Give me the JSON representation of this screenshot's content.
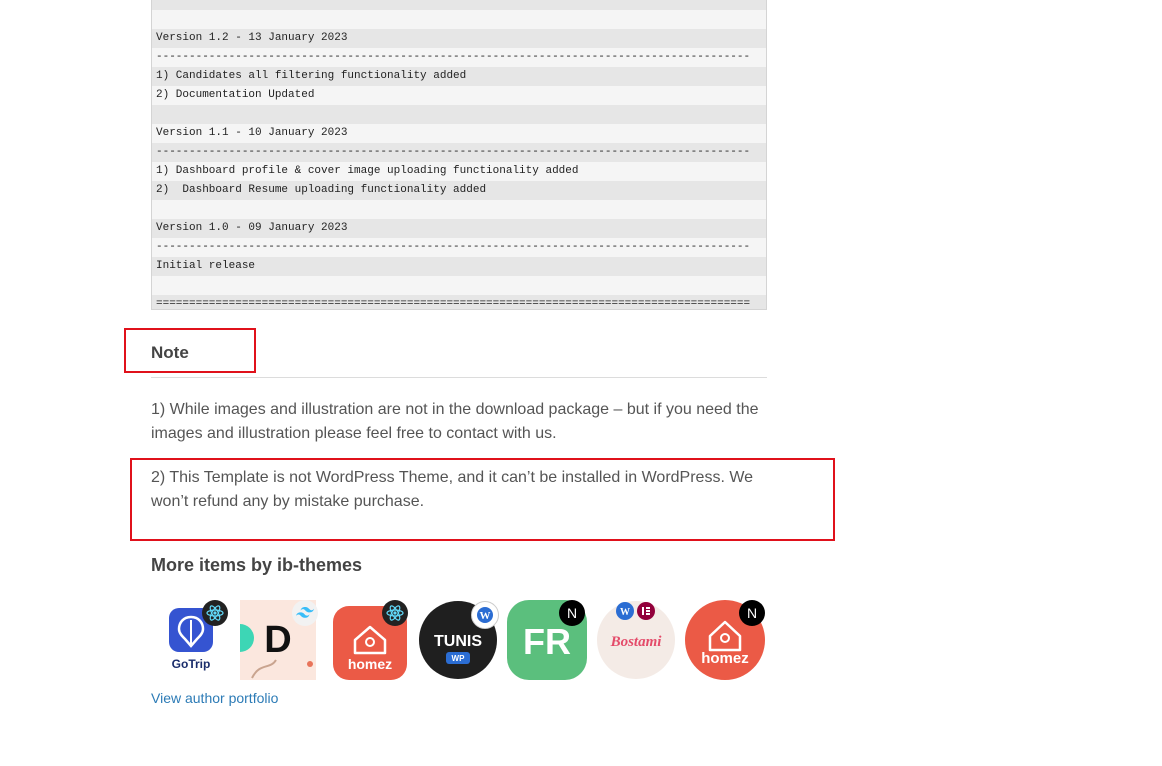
{
  "changelog": {
    "lines": [
      "",
      "",
      "Version 1.2 - 13 January 2023",
      "------------------------------------------------------------------------------------------",
      "1) Candidates all filtering functionality added",
      "2) Documentation Updated",
      "",
      "Version 1.1 - 10 January 2023",
      "------------------------------------------------------------------------------------------",
      "1) Dashboard profile & cover image uploading functionality added",
      "2)  Dashboard Resume uploading functionality added",
      "",
      "Version 1.0 - 09 January 2023",
      "------------------------------------------------------------------------------------------",
      "Initial release",
      "",
      "=========================================================================================="
    ]
  },
  "note": {
    "title": "Note",
    "items": [
      "1) While images and illustration are not in the download package – but if you need the images and illustration please feel free to contact with us.",
      "2) This Template is not WordPress Theme, and it can’t be installed in WordPress. We won’t refund any by mistake purchase."
    ]
  },
  "more_items": {
    "title": "More items by ib-themes",
    "thumbnails": [
      {
        "label": "GoTrip",
        "icon": "gotrip-logo",
        "badge": "react-icon"
      },
      {
        "label": "D",
        "icon": "d-logo",
        "badge": "tailwind-icon"
      },
      {
        "label": "homez",
        "icon": "homez-logo",
        "badge": "react-icon"
      },
      {
        "label": "TUNIS",
        "sublabel": "WP",
        "icon": "tunis-logo",
        "badge": "wordpress-icon"
      },
      {
        "label": "FR",
        "icon": "fr-logo",
        "badge": "nextjs-icon"
      },
      {
        "label": "Bostami",
        "icon": "bostami-logo",
        "badge": "wordpress-elementor-icon"
      },
      {
        "label": "homez",
        "icon": "homez-logo",
        "badge": "nextjs-icon"
      }
    ],
    "portfolio_link": "View author portfolio"
  },
  "colors": {
    "highlight": "#e0111b",
    "link": "#2c7bb6"
  }
}
